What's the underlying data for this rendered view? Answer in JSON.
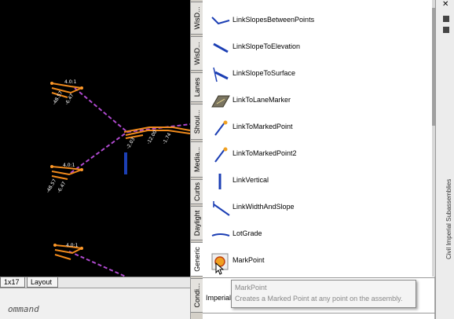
{
  "layout_tabs": [
    "1x17",
    "Layout"
  ],
  "command_prompt": "ommand",
  "vertical_tabs": [
    "WisD...",
    "WisD...",
    "Lanes",
    "Shoul...",
    "Media...",
    "Curbs",
    "Daylight",
    "Generic",
    "Condi..."
  ],
  "active_tab": "Generic",
  "palette_items": [
    {
      "label": "LinkSlopesBetweenPoints",
      "icon": "link-slopes-between-points-icon"
    },
    {
      "label": "LinkSlopeToElevation",
      "icon": "link-slope-to-elevation-icon"
    },
    {
      "label": "LinkSlopeToSurface",
      "icon": "link-slope-to-surface-icon"
    },
    {
      "label": "LinkToLaneMarker",
      "icon": "link-to-lane-marker-icon"
    },
    {
      "label": "LinkToMarkedPoint",
      "icon": "link-to-marked-point-icon"
    },
    {
      "label": "LinkToMarkedPoint2",
      "icon": "link-to-marked-point2-icon"
    },
    {
      "label": "LinkVertical",
      "icon": "link-vertical-icon"
    },
    {
      "label": "LinkWidthAndSlope",
      "icon": "link-width-and-slope-icon"
    },
    {
      "label": "LotGrade",
      "icon": "lot-grade-icon"
    },
    {
      "label": "MarkPoint",
      "icon": "mark-point-icon"
    }
  ],
  "palette_units": "Imperial",
  "tooltip": {
    "title": "MarkPoint",
    "description": "Creates a Marked Point at any point on the assembly."
  },
  "edge_panel_title": "Civil Imperial Subassemblies",
  "colors": {
    "link_blue": "#1c3fb4",
    "drawing_orange": "#f08a1c",
    "magenta_dash": "#b04ad0"
  }
}
